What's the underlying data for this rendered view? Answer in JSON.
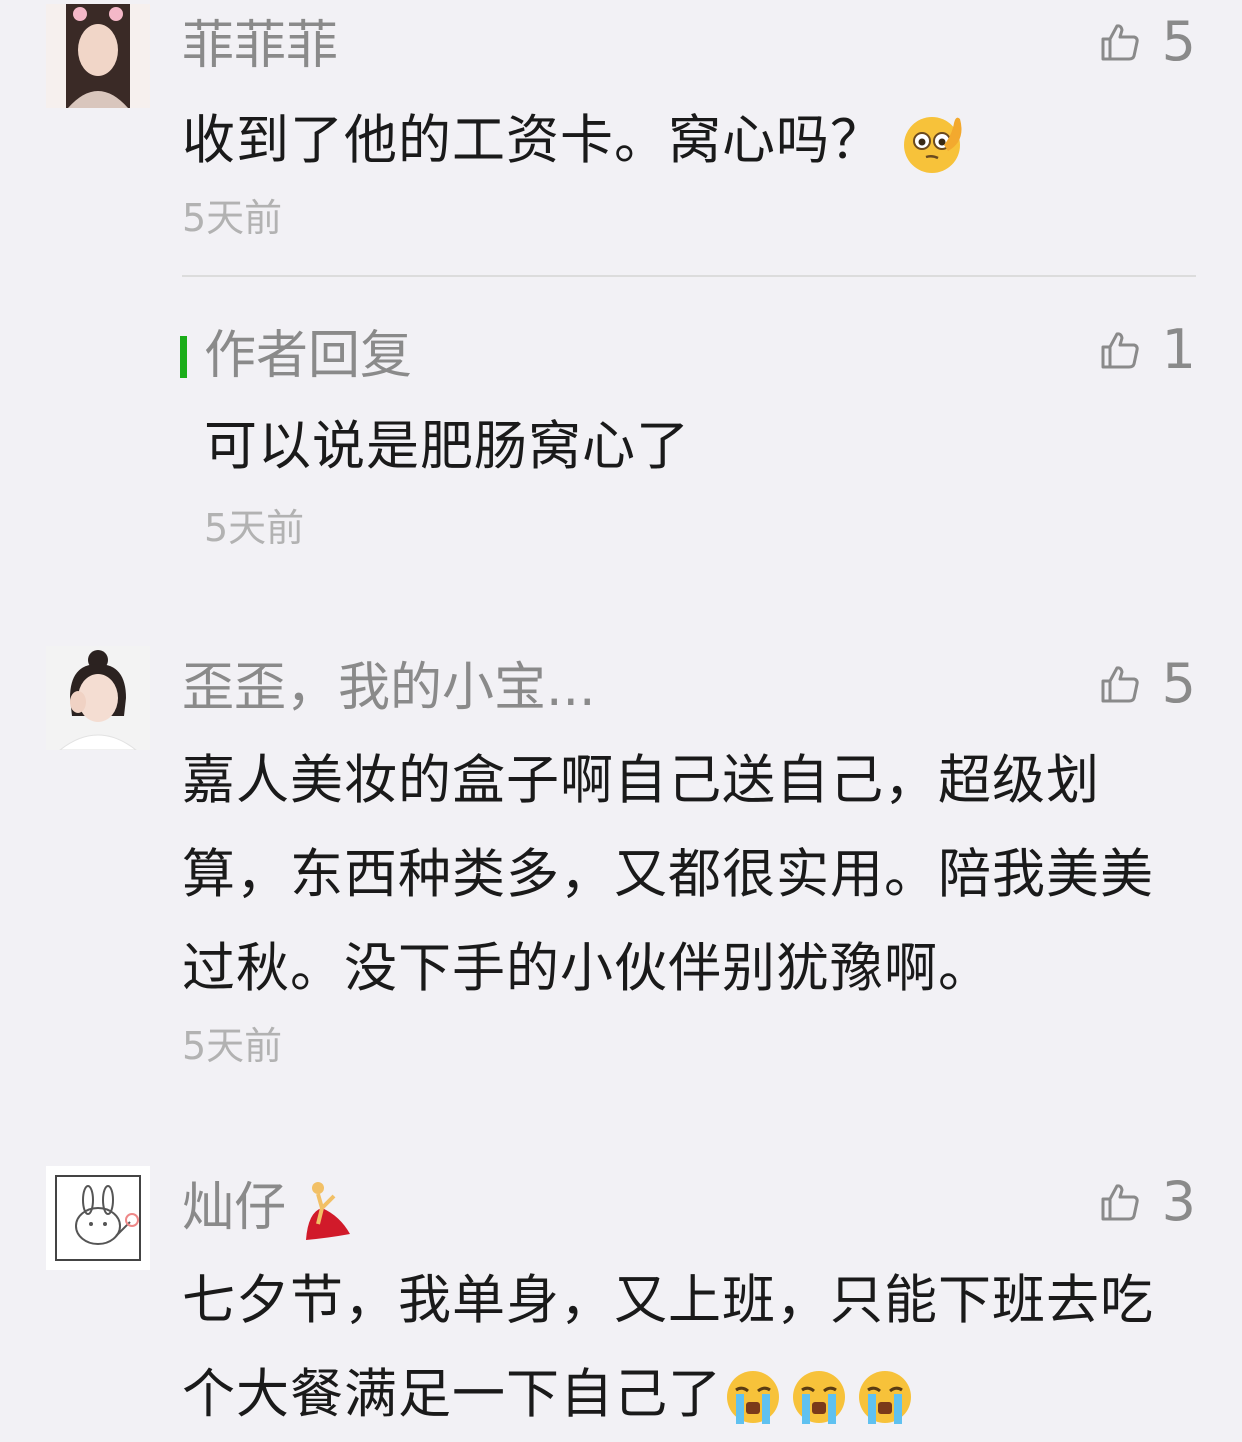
{
  "comments": [
    {
      "nickname": "菲菲菲",
      "likes": "5",
      "text": "收到了他的工资卡。窝心吗？",
      "time": "5天前",
      "reply": {
        "label": "作者回复",
        "likes": "1",
        "text": "可以说是肥肠窝心了",
        "time": "5天前"
      }
    },
    {
      "nickname": "歪歪，我的小宝...",
      "likes": "5",
      "text": "嘉人美妆的盒子啊自己送自己，超级划算，东西种类多，又都很实用。陪我美美过秋。没下手的小伙伴别犹豫啊。",
      "time": "5天前"
    },
    {
      "nickname": "灿仔",
      "likes": "3",
      "text": "七夕节，我单身，又上班，只能下班去吃个大餐满足一下自己了"
    }
  ],
  "colors": {
    "background": "#f2f1f5",
    "reply_accent": "#1aad19",
    "meta_text": "#8a8a8a",
    "time_text": "#b2b2b2"
  },
  "icons": [
    "thumbs-up-icon",
    "thinking-face-emoji",
    "dancer-emoji",
    "crying-face-emoji"
  ]
}
